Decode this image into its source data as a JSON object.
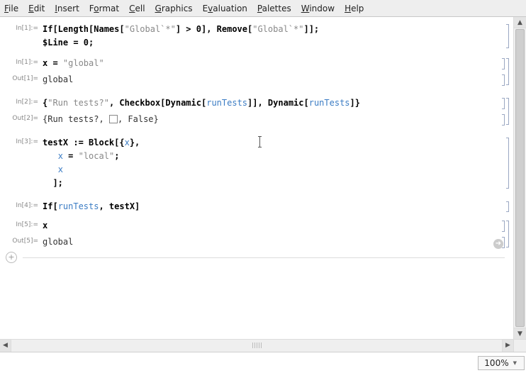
{
  "menu": {
    "file": "File",
    "edit": "Edit",
    "insert": "Insert",
    "format": "Format",
    "cell": "Cell",
    "graphics": "Graphics",
    "evaluation": "Evaluation",
    "palettes": "Palettes",
    "window": "Window",
    "help": "Help"
  },
  "cells": {
    "in1a": {
      "label": "In[1]:=",
      "code_prefix": "If[Length[Names[",
      "str1": "\"Global`*\"",
      "mid1": "] > 0], Remove[",
      "str2": "\"Global`*\"",
      "suffix": "]];",
      "line2_prefix": "$Line = 0;"
    },
    "in1b": {
      "label": "In[1]:=",
      "code_prefix": "x = ",
      "str1": "\"global\""
    },
    "out1": {
      "label": "Out[1]=",
      "text": "global"
    },
    "in2": {
      "label": "In[2]:=",
      "open": "{",
      "str1": "\"Run tests?\"",
      "sep1": ", Checkbox[Dynamic[",
      "sym1": "runTests",
      "sep2": "]], Dynamic[",
      "sym2": "runTests",
      "close": "]}"
    },
    "out2": {
      "label": "Out[2]=",
      "open": "{",
      "text1": "Run tests?",
      "sep1": ", ",
      "sep2": ", ",
      "val": "False",
      "close": "}"
    },
    "in3": {
      "label": "In[3]:=",
      "l1_a": "testX := Block[{",
      "l1_sym": "x",
      "l1_b": "},",
      "l2_sym": "x",
      "l2_a": " = ",
      "l2_str": "\"local\"",
      "l2_b": ";",
      "l3_sym": "x",
      "l4": "];"
    },
    "in4": {
      "label": "In[4]:=",
      "a": "If[",
      "sym1": "runTests",
      "b": ", testX]"
    },
    "in5": {
      "label": "In[5]:=",
      "text": "x"
    },
    "out5": {
      "label": "Out[5]=",
      "text": "global"
    }
  },
  "status": {
    "zoom": "100%"
  },
  "icons": {
    "plus": "+",
    "arrow": "➜"
  }
}
